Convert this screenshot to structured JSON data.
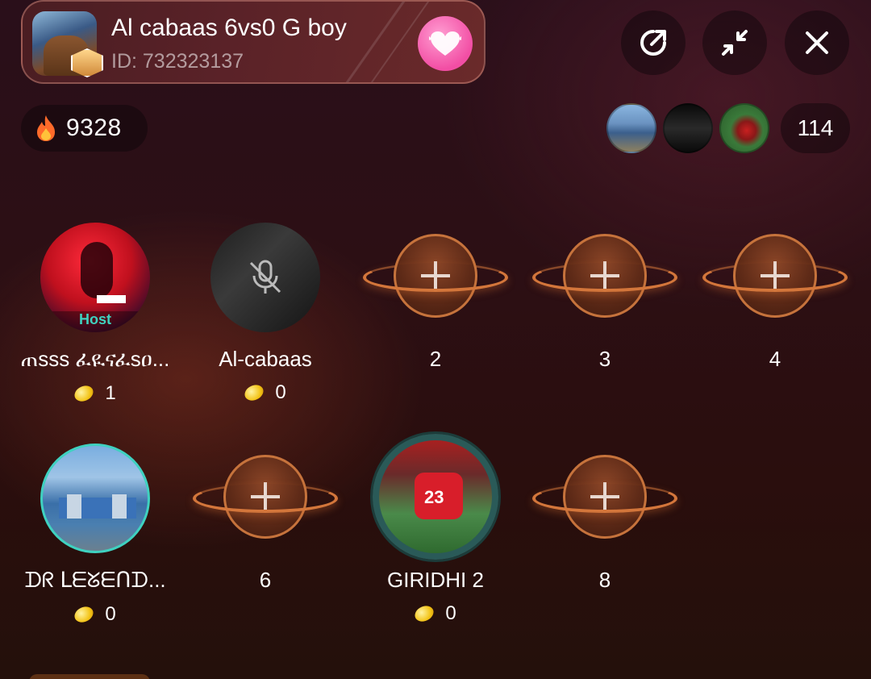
{
  "room": {
    "title": "Al cabaas 6vs0 G boy",
    "id_label": "ID: 732323137"
  },
  "toolbar": {
    "share_icon": "share-icon",
    "minimize_icon": "minimize-icon",
    "close_icon": "close-icon"
  },
  "stats": {
    "hot_value": "9328",
    "viewer_count": "114"
  },
  "seats": [
    {
      "name": "ጠsss ፈዪናፈsዐ...",
      "coins": "1",
      "tag": "Host"
    },
    {
      "name": "Al-cabaas",
      "coins": "0"
    },
    {
      "name": "2"
    },
    {
      "name": "3"
    },
    {
      "name": "4"
    },
    {
      "name": "ᗪᖇ ᒪᗴᘜᗴᑎᗪ...",
      "coins": "0"
    },
    {
      "name": "6"
    },
    {
      "name": "GIRIDHI 2",
      "coins": "0"
    },
    {
      "name": "8"
    }
  ],
  "colors": {
    "accent_teal": "#3fd1c0",
    "planet_orange": "#d3763b",
    "heart_pink": "#f24ea4"
  }
}
